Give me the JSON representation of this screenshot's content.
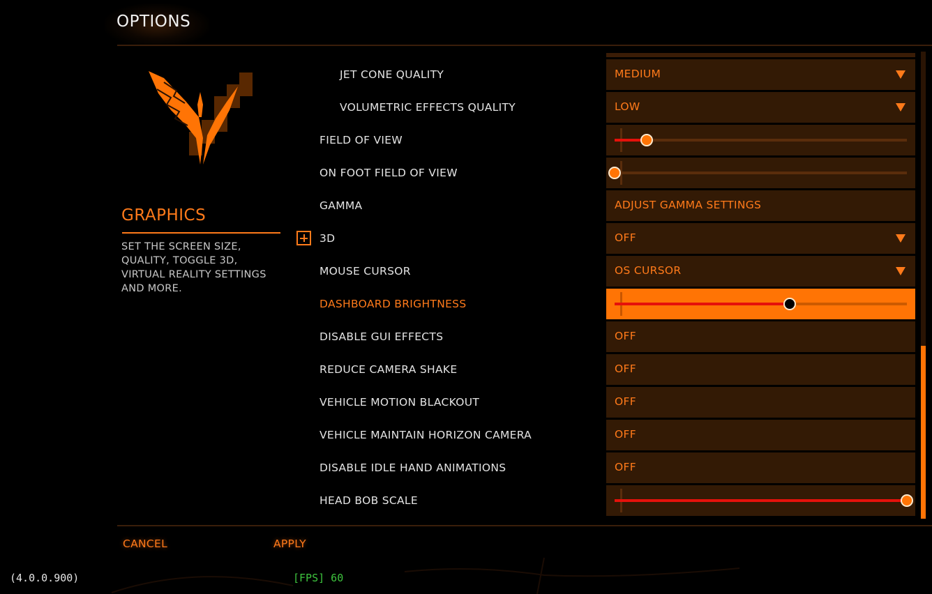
{
  "header": {
    "title": "OPTIONS"
  },
  "section": {
    "title": "GRAPHICS",
    "description": "SET THE SCREEN SIZE, QUALITY, TOGGLE 3D, VIRTUAL REALITY SETTINGS AND MORE."
  },
  "logo": {
    "icon": "elite-dangerous-emblem-icon"
  },
  "settings": [
    {
      "label": "JET CONE QUALITY",
      "type": "dropdown",
      "value": "MEDIUM",
      "indent": true
    },
    {
      "label": "VOLUMETRIC EFFECTS QUALITY",
      "type": "dropdown",
      "value": "LOW",
      "indent": true
    },
    {
      "label": "FIELD OF VIEW",
      "type": "slider",
      "value_fraction": 0.11
    },
    {
      "label": "ON FOOT FIELD OF VIEW",
      "type": "slider",
      "value_fraction": 0.0
    },
    {
      "label": "GAMMA",
      "type": "button",
      "value": "ADJUST GAMMA SETTINGS"
    },
    {
      "label": "3D",
      "type": "dropdown",
      "value": "OFF",
      "expandable": true
    },
    {
      "label": "MOUSE CURSOR",
      "type": "dropdown",
      "value": "OS CURSOR"
    },
    {
      "label": "DASHBOARD BRIGHTNESS",
      "type": "slider",
      "value_fraction": 0.6,
      "selected": true
    },
    {
      "label": "DISABLE GUI EFFECTS",
      "type": "toggle",
      "value": "OFF"
    },
    {
      "label": "REDUCE CAMERA SHAKE",
      "type": "toggle",
      "value": "OFF"
    },
    {
      "label": "VEHICLE MOTION BLACKOUT",
      "type": "toggle",
      "value": "OFF"
    },
    {
      "label": "VEHICLE MAINTAIN HORIZON CAMERA",
      "type": "toggle",
      "value": "OFF"
    },
    {
      "label": "DISABLE IDLE HAND ANIMATIONS",
      "type": "toggle",
      "value": "OFF"
    },
    {
      "label": "HEAD BOB SCALE",
      "type": "slider",
      "value_fraction": 1.0
    }
  ],
  "scrollbar": {
    "position_fraction": 0.63,
    "visible_fraction": 0.37
  },
  "footer": {
    "cancel_label": "CANCEL",
    "apply_label": "APPLY"
  },
  "status": {
    "version": "(4.0.0.900)",
    "fps": "[FPS] 60"
  },
  "colors": {
    "accent": "#ff7a1a",
    "control_bg": "#331a05",
    "selected_bg": "#ff7405",
    "slider_fill": "#e5110b",
    "fps_text": "#3ec43e"
  }
}
